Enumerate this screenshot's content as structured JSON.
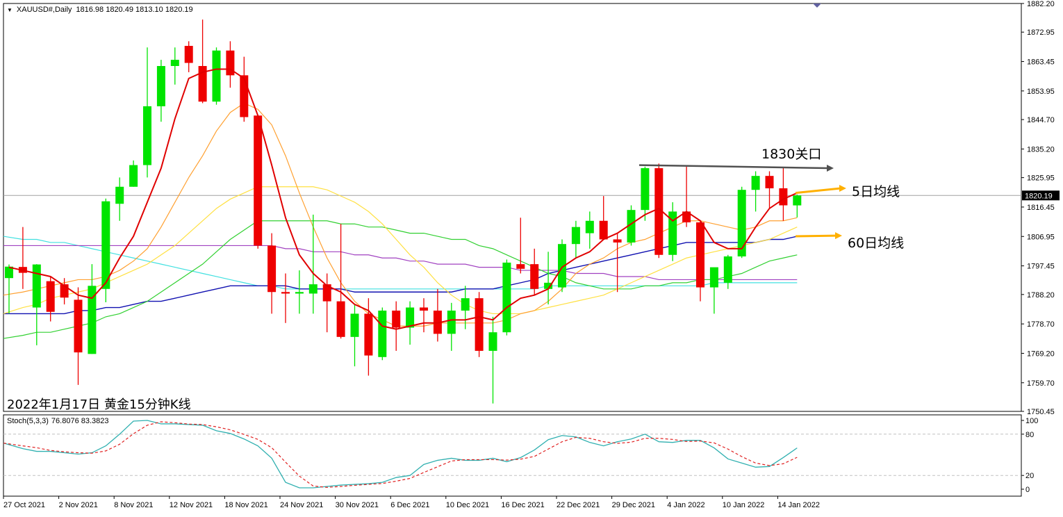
{
  "header": {
    "symbol": "XAUUSD#,Daily",
    "ohlc": "1816.98 1820.49 1813.10 1820.19"
  },
  "stoch_header": {
    "label": "Stoch(5,3,3)",
    "values": "76.8076 83.3823"
  },
  "caption": "2022年1月17日 黄金15分钟K线",
  "annotations": {
    "level_1830": "1830关口",
    "ma5": "5日均线",
    "ma60": "60日均线"
  },
  "colors": {
    "up": "#00e400",
    "down": "#ee0000",
    "ma5": "#e00000",
    "ma10": "#ffa030",
    "ma20": "#ffe040",
    "ma30": "#30d030",
    "ma60": "#1010b0",
    "ma120": "#a040c0",
    "ma_cyan": "#40e0e0",
    "arrow_orange": "#ffb000",
    "arrow_gray": "#505050",
    "stoch_main": "#30b0b0",
    "stoch_signal": "#e02020",
    "grid": "#c0c0c0"
  },
  "chart_data": {
    "type": "candlestick",
    "symbol": "XAUUSD#",
    "timeframe": "Daily",
    "current_price": 1820.19,
    "current_price_label": "1820.19",
    "ylim": [
      1750.45,
      1882.2
    ],
    "y_ticks": [
      "1882.20",
      "1872.95",
      "1863.45",
      "1853.95",
      "1844.70",
      "1835.20",
      "1825.95",
      "1816.45",
      "1806.95",
      "1797.45",
      "1788.20",
      "1778.70",
      "1769.20",
      "1759.70",
      "1750.45"
    ],
    "x_ticks": [
      {
        "i": 0,
        "label": "27 Oct 2021"
      },
      {
        "i": 4,
        "label": "2 Nov 2021"
      },
      {
        "i": 8,
        "label": "8 Nov 2021"
      },
      {
        "i": 12,
        "label": "12 Nov 2021"
      },
      {
        "i": 16,
        "label": "18 Nov 2021"
      },
      {
        "i": 20,
        "label": "24 Nov 2021"
      },
      {
        "i": 24,
        "label": "30 Nov 2021"
      },
      {
        "i": 28,
        "label": "6 Dec 2021"
      },
      {
        "i": 32,
        "label": "10 Dec 2021"
      },
      {
        "i": 36,
        "label": "16 Dec 2021"
      },
      {
        "i": 40,
        "label": "22 Dec 2021"
      },
      {
        "i": 44,
        "label": "29 Dec 2021"
      },
      {
        "i": 48,
        "label": "4 Jan 2022"
      },
      {
        "i": 52,
        "label": "10 Jan 2022"
      },
      {
        "i": 56,
        "label": "14 Jan 2022"
      }
    ],
    "candles": [
      {
        "o": 1793.5,
        "h": 1797.9,
        "l": 1782.0,
        "c": 1797.2
      },
      {
        "o": 1797.1,
        "h": 1810.0,
        "l": 1790.0,
        "c": 1795.2
      },
      {
        "o": 1784.0,
        "h": 1798.0,
        "l": 1771.8,
        "c": 1797.9
      },
      {
        "o": 1792.5,
        "h": 1794.0,
        "l": 1779.5,
        "c": 1782.6
      },
      {
        "o": 1791.5,
        "h": 1793.5,
        "l": 1785.0,
        "c": 1787.2
      },
      {
        "o": 1786.5,
        "h": 1790.5,
        "l": 1759.0,
        "c": 1769.5
      },
      {
        "o": 1769.0,
        "h": 1798.0,
        "l": 1769.0,
        "c": 1791.0
      },
      {
        "o": 1790.0,
        "h": 1819.2,
        "l": 1785.7,
        "c": 1818.3
      },
      {
        "o": 1817.5,
        "h": 1826.0,
        "l": 1812.0,
        "c": 1823.0
      },
      {
        "o": 1823.0,
        "h": 1831.5,
        "l": 1823.0,
        "c": 1830.0
      },
      {
        "o": 1830.0,
        "h": 1868.0,
        "l": 1826.0,
        "c": 1849.0
      },
      {
        "o": 1849.0,
        "h": 1864.0,
        "l": 1844.0,
        "c": 1862.0
      },
      {
        "o": 1862.0,
        "h": 1868.0,
        "l": 1856.0,
        "c": 1864.0
      },
      {
        "o": 1868.5,
        "h": 1870.0,
        "l": 1860.0,
        "c": 1863.0
      },
      {
        "o": 1862.0,
        "h": 1877.0,
        "l": 1850.0,
        "c": 1850.5
      },
      {
        "o": 1850.5,
        "h": 1868.0,
        "l": 1849.5,
        "c": 1867.0
      },
      {
        "o": 1867.0,
        "h": 1870.0,
        "l": 1855.0,
        "c": 1859.0
      },
      {
        "o": 1859.0,
        "h": 1865.0,
        "l": 1844.0,
        "c": 1845.5
      },
      {
        "o": 1846.0,
        "h": 1846.0,
        "l": 1803.0,
        "c": 1804.0
      },
      {
        "o": 1804.0,
        "h": 1808.0,
        "l": 1782.0,
        "c": 1789.0
      },
      {
        "o": 1789.0,
        "h": 1795.0,
        "l": 1779.0,
        "c": 1788.5
      },
      {
        "o": 1788.5,
        "h": 1796.0,
        "l": 1782.0,
        "c": 1789.0
      },
      {
        "o": 1788.5,
        "h": 1814.0,
        "l": 1782.0,
        "c": 1791.5
      },
      {
        "o": 1791.5,
        "h": 1795.0,
        "l": 1776.0,
        "c": 1786.0
      },
      {
        "o": 1786.0,
        "h": 1811.0,
        "l": 1774.0,
        "c": 1774.5
      },
      {
        "o": 1774.5,
        "h": 1785.0,
        "l": 1765.0,
        "c": 1782.0
      },
      {
        "o": 1782.0,
        "h": 1787.0,
        "l": 1762.0,
        "c": 1768.5
      },
      {
        "o": 1768.0,
        "h": 1784.0,
        "l": 1767.0,
        "c": 1783.0
      },
      {
        "o": 1783.0,
        "h": 1786.0,
        "l": 1770.0,
        "c": 1777.5
      },
      {
        "o": 1777.5,
        "h": 1786.0,
        "l": 1772.0,
        "c": 1784.0
      },
      {
        "o": 1784.0,
        "h": 1787.0,
        "l": 1776.0,
        "c": 1783.0
      },
      {
        "o": 1783.0,
        "h": 1790.0,
        "l": 1773.0,
        "c": 1775.5
      },
      {
        "o": 1775.5,
        "h": 1785.5,
        "l": 1770.0,
        "c": 1783.0
      },
      {
        "o": 1783.0,
        "h": 1791.0,
        "l": 1777.0,
        "c": 1787.0
      },
      {
        "o": 1787.0,
        "h": 1789.0,
        "l": 1768.0,
        "c": 1770.0
      },
      {
        "o": 1770.0,
        "h": 1781.0,
        "l": 1753.0,
        "c": 1776.0
      },
      {
        "o": 1776.0,
        "h": 1799.5,
        "l": 1775.0,
        "c": 1798.5
      },
      {
        "o": 1798.0,
        "h": 1813.0,
        "l": 1795.0,
        "c": 1796.5
      },
      {
        "o": 1798.0,
        "h": 1803.0,
        "l": 1788.0,
        "c": 1790.0
      },
      {
        "o": 1790.0,
        "h": 1802.0,
        "l": 1785.0,
        "c": 1792.0
      },
      {
        "o": 1790.5,
        "h": 1806.0,
        "l": 1789.0,
        "c": 1804.5
      },
      {
        "o": 1804.5,
        "h": 1812.0,
        "l": 1800.0,
        "c": 1810.0
      },
      {
        "o": 1808.0,
        "h": 1815.0,
        "l": 1803.0,
        "c": 1812.0
      },
      {
        "o": 1812.0,
        "h": 1820.0,
        "l": 1806.0,
        "c": 1806.0
      },
      {
        "o": 1806.0,
        "h": 1808.0,
        "l": 1789.0,
        "c": 1805.0
      },
      {
        "o": 1805.0,
        "h": 1817.0,
        "l": 1804.0,
        "c": 1815.5
      },
      {
        "o": 1815.5,
        "h": 1829.5,
        "l": 1812.0,
        "c": 1829.0
      },
      {
        "o": 1829.0,
        "h": 1830.5,
        "l": 1800.0,
        "c": 1801.0
      },
      {
        "o": 1801.0,
        "h": 1818.0,
        "l": 1799.0,
        "c": 1815.0
      },
      {
        "o": 1815.0,
        "h": 1829.5,
        "l": 1810.0,
        "c": 1811.5
      },
      {
        "o": 1811.5,
        "h": 1812.0,
        "l": 1786.0,
        "c": 1790.5
      },
      {
        "o": 1790.5,
        "h": 1796.0,
        "l": 1782.0,
        "c": 1797.0
      },
      {
        "o": 1792.0,
        "h": 1801.0,
        "l": 1790.0,
        "c": 1800.5
      },
      {
        "o": 1800.5,
        "h": 1823.0,
        "l": 1800.0,
        "c": 1822.0
      },
      {
        "o": 1822.0,
        "h": 1828.0,
        "l": 1815.0,
        "c": 1826.5
      },
      {
        "o": 1826.5,
        "h": 1828.0,
        "l": 1816.0,
        "c": 1822.5
      },
      {
        "o": 1822.5,
        "h": 1829.0,
        "l": 1812.0,
        "c": 1817.0
      },
      {
        "o": 1816.98,
        "h": 1820.49,
        "l": 1813.1,
        "c": 1820.19
      }
    ],
    "moving_averages": {
      "ma5": [
        1797,
        1796,
        1795,
        1794,
        1791,
        1788,
        1787,
        1792,
        1800,
        1807,
        1818,
        1829,
        1845,
        1858,
        1860,
        1861,
        1861,
        1858,
        1846,
        1830,
        1813,
        1801,
        1795,
        1791,
        1789,
        1785,
        1783,
        1778,
        1777,
        1778,
        1779,
        1779,
        1780,
        1780,
        1781,
        1780,
        1784,
        1787,
        1788,
        1790,
        1797,
        1800,
        1802,
        1806,
        1808,
        1811,
        1814,
        1816,
        1812,
        1815,
        1812,
        1805,
        1803,
        1803,
        1810,
        1816,
        1819,
        1821
      ],
      "ma10": [
        1788,
        1789,
        1790,
        1791,
        1792,
        1793,
        1793,
        1794,
        1796,
        1799,
        1803,
        1810,
        1818,
        1826,
        1833,
        1841,
        1847,
        1850,
        1848,
        1843,
        1833,
        1821,
        1810,
        1800,
        1792,
        1786,
        1782,
        1780,
        1778,
        1778,
        1778,
        1779,
        1779,
        1779,
        1779,
        1779,
        1780,
        1782,
        1783,
        1786,
        1790,
        1795,
        1798,
        1800,
        1803,
        1805,
        1806,
        1808,
        1810,
        1812,
        1812,
        1811,
        1810,
        1809,
        1810,
        1812,
        1812,
        1813
      ],
      "ma20": [
        1782,
        1784,
        1785,
        1787,
        1788,
        1789,
        1790,
        1792,
        1794,
        1796,
        1798,
        1801,
        1804,
        1808,
        1812,
        1816,
        1819,
        1821,
        1823,
        1823,
        1823,
        1823,
        1823,
        1822,
        1820,
        1818,
        1815,
        1811,
        1806,
        1801,
        1797,
        1792,
        1788,
        1785,
        1783,
        1782,
        1782,
        1782,
        1783,
        1784,
        1785,
        1786,
        1787,
        1788,
        1790,
        1792,
        1794,
        1796,
        1798,
        1800,
        1801,
        1802,
        1803,
        1804,
        1805,
        1806,
        1808,
        1810
      ],
      "ma30": [
        1774,
        1775,
        1776,
        1776,
        1777,
        1778,
        1779,
        1781,
        1782,
        1784,
        1786,
        1789,
        1792,
        1795,
        1798,
        1802,
        1806,
        1809,
        1812,
        1812,
        1812,
        1812,
        1812,
        1812,
        1811,
        1811,
        1810,
        1810,
        1809,
        1808,
        1808,
        1807,
        1806,
        1806,
        1804,
        1803,
        1801,
        1799,
        1797,
        1795,
        1794,
        1792,
        1791,
        1790,
        1790,
        1790,
        1791,
        1791,
        1792,
        1792,
        1793,
        1793,
        1794,
        1795,
        1797,
        1799,
        1800,
        1801
      ],
      "ma60": [
        1782,
        1782,
        1782,
        1782,
        1782,
        1783,
        1783,
        1784,
        1784,
        1785,
        1786,
        1786,
        1787,
        1788,
        1789,
        1790,
        1791,
        1791,
        1791,
        1791,
        1791,
        1790,
        1790,
        1790,
        1790,
        1789,
        1789,
        1789,
        1789,
        1789,
        1789,
        1789,
        1789,
        1790,
        1790,
        1790,
        1791,
        1792,
        1793,
        1795,
        1796,
        1797,
        1798,
        1799,
        1800,
        1801,
        1802,
        1803,
        1804,
        1805,
        1805,
        1805,
        1805,
        1805,
        1805,
        1806,
        1806,
        1807
      ],
      "ma120": [
        1804,
        1804,
        1804,
        1804,
        1804,
        1804,
        1804,
        1804,
        1804,
        1804,
        1804,
        1804,
        1804,
        1804,
        1804,
        1804,
        1804,
        1804,
        1804,
        1804,
        1803,
        1803,
        1802,
        1802,
        1802,
        1801,
        1801,
        1800,
        1800,
        1799,
        1799,
        1798,
        1798,
        1798,
        1797,
        1797,
        1797,
        1796,
        1796,
        1796,
        1796,
        1795,
        1795,
        1795,
        1794,
        1794,
        1794,
        1793,
        1793,
        1793,
        1793,
        1793,
        1793,
        1793,
        1793,
        1793,
        1793,
        1793
      ],
      "ma_cyan": [
        1807,
        1806,
        1806,
        1805,
        1805,
        1804,
        1803,
        1802,
        1801,
        1800,
        1799,
        1798,
        1797,
        1796,
        1795,
        1794,
        1793,
        1792,
        1791,
        1791,
        1790,
        1790,
        1790,
        1790,
        1790,
        1790,
        1790,
        1790,
        1790,
        1790,
        1790,
        1790,
        1790,
        1790,
        1790,
        1790,
        1790,
        1790,
        1790,
        1791,
        1791,
        1791,
        1791,
        1791,
        1791,
        1791,
        1791,
        1791,
        1791,
        1791,
        1791,
        1792,
        1792,
        1792,
        1792,
        1792,
        1792,
        1792
      ]
    },
    "stochastic": {
      "y_ticks": [
        100,
        80,
        20,
        0
      ],
      "levels": [
        80,
        20
      ],
      "main": [
        67,
        59,
        55,
        55,
        53,
        51,
        53,
        63,
        80,
        99,
        100,
        95,
        95,
        94,
        93,
        85,
        81,
        73,
        63,
        45,
        10,
        2,
        2,
        4,
        6,
        7,
        8,
        10,
        17,
        20,
        36,
        42,
        45,
        42,
        42,
        45,
        40,
        46,
        57,
        72,
        78,
        76,
        68,
        63,
        69,
        73,
        80,
        69,
        68,
        71,
        71,
        60,
        44,
        38,
        32,
        33,
        46,
        60
      ]
    },
    "annotations": [
      {
        "text": "1830关口",
        "price": 1830.0
      },
      {
        "text": "5日均线",
        "price": 1821.0
      },
      {
        "text": "60日均线",
        "price": 1807.0
      }
    ]
  }
}
